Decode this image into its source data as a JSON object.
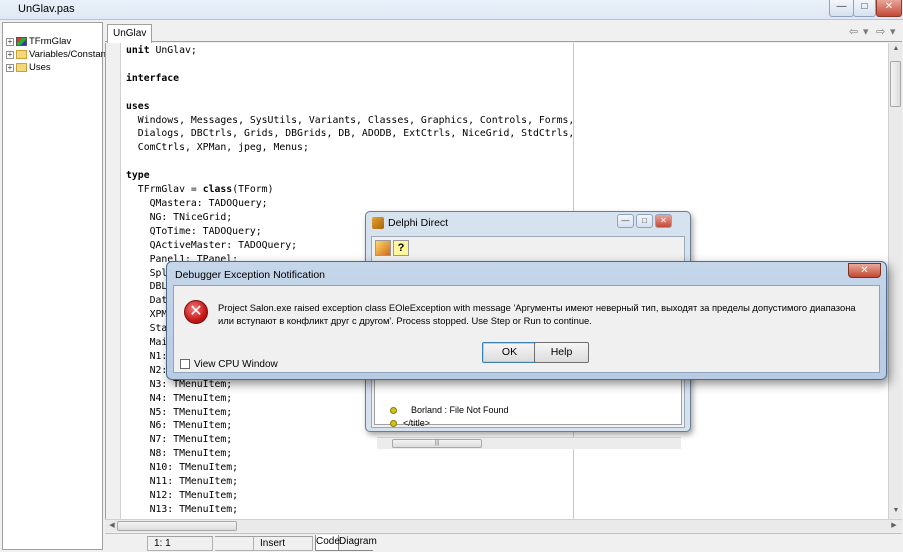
{
  "window": {
    "title": "UnGlav.pas",
    "min_glyph": "—",
    "max_glyph": "□",
    "close_glyph": "✕"
  },
  "explorer": {
    "items": [
      {
        "label": "TFrmGlav",
        "icon": "form-icon"
      },
      {
        "label": "Variables/Constants",
        "icon": "folder-icon"
      },
      {
        "label": "Uses",
        "icon": "folder-icon"
      }
    ],
    "expander": "+"
  },
  "editor": {
    "tab_label": "UnGlav",
    "nav_back": "⇦",
    "nav_forward": "⇨",
    "nav_dropdown": "▾",
    "code_lines": [
      "unit UnGlav;",
      "",
      "interface",
      "",
      "uses",
      "  Windows, Messages, SysUtils, Variants, Classes, Graphics, Controls, Forms,",
      "  Dialogs, DBCtrls, Grids, DBGrids, DB, ADODB, ExtCtrls, NiceGrid, StdCtrls,",
      "  ComCtrls, XPMan, jpeg, Menus;",
      "",
      "type",
      "  TFrmGlav = class(TForm)",
      "    QMastera: TADOQuery;",
      "    NG: TNiceGrid;",
      "    QToTime: TADOQuery;",
      "    QActiveMaster: TADOQuery;",
      "    Panel1: TPanel;",
      "    Spli",
      "    DBLo",
      "    Date",
      "    XPMa",
      "    Stat",
      "    Main",
      "    N1:",
      "    N2:",
      "    N3: TMenuItem;",
      "    N4: TMenuItem;",
      "    N5: TMenuItem;",
      "    N6: TMenuItem;",
      "    N7: TMenuItem;",
      "    N8: TMenuItem;",
      "    N10: TMenuItem;",
      "    N11: TMenuItem;",
      "    N12: TMenuItem;",
      "    N13: TMenuItem;"
    ]
  },
  "statusbar": {
    "position": "1:   1",
    "mode": "Insert",
    "tab_code": "Code",
    "tab_diagram": "Diagram"
  },
  "delphi_direct": {
    "title": "Delphi Direct",
    "help_glyph": "?",
    "item_text": "Borland : File Not Found",
    "item2_text": "</title>",
    "scroll_grip": "|||"
  },
  "exception_dialog": {
    "title": "Debugger Exception Notification",
    "close_glyph": "✕",
    "icon_glyph": "✕",
    "message": "Project Salon.exe raised exception class EOleException with message 'Аргументы имеют неверный тип, выходят за пределы допустимого диапазона или вступают в конфликт друг с другом'. Process stopped. Use Step or Run to continue.",
    "ok_label": "OK",
    "help_label": "Help",
    "cpu_checkbox_label": "View CPU Window"
  }
}
